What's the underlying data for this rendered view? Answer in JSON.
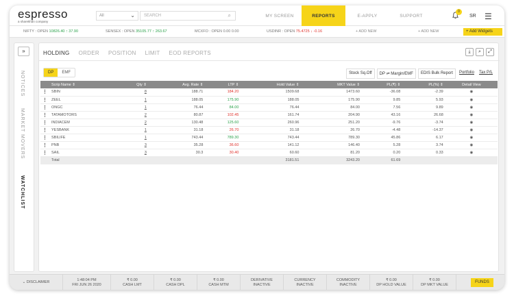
{
  "brand": {
    "name": "espresso",
    "tagline": "a sharekhan company"
  },
  "header": {
    "exchange_selector": "All",
    "search_placeholder": "SEARCH",
    "nav": [
      "MY SCREEN",
      "REPORTS",
      "E-APPLY",
      "SUPPORT"
    ],
    "active_nav": "REPORTS",
    "notification_count": "0",
    "user_initials": "SR"
  },
  "indices": [
    {
      "name": "NIFTY : OPEN",
      "value": "10826.40",
      "change": "37.90",
      "dir": "up"
    },
    {
      "name": "SENSEX : OPEN",
      "value": "35105.77",
      "change": "263.67",
      "dir": "up"
    },
    {
      "name": "MCXFO : OPEN",
      "value": "0.00",
      "change": "0.00",
      "dir": "none"
    },
    {
      "name": "USDINR : OPEN",
      "value": "75.4725",
      "change": "-0.16",
      "dir": "dn"
    }
  ],
  "index_actions": {
    "add_new_1": "+ ADD NEW",
    "add_new_2": "+ ADD NEW",
    "add_widgets": "+ Add Widgets"
  },
  "side_rail": {
    "items": [
      "NOTICES",
      "MARKET MOVERS",
      "WATCHLIST"
    ],
    "active": "WATCHLIST"
  },
  "tabs": [
    "HOLDING",
    "ORDER",
    "POSITION",
    "LIMIT",
    "EOD REPORTS"
  ],
  "active_tab": "HOLDING",
  "segment": {
    "options": [
      "DP",
      "EMF"
    ],
    "active": "DP"
  },
  "actions": {
    "sqoff": "Stock Sq.Off",
    "dp_margin": "DP ⇌ Margin/EMF",
    "edis": "EDIS Bulk Report",
    "portfolio": "Portfolio",
    "tax": "Tax P/L"
  },
  "table": {
    "headers": [
      "Scrip Name ⇕",
      "Qty ⇕",
      "Avg. Rate ⇕",
      "LTP ⇕",
      "Hold Value ⇕",
      "MKT Value ⇕",
      "PL(₹) ⇕",
      "PL(%) ⇕",
      "Detail View"
    ],
    "rows": [
      {
        "scrip": "SBIN",
        "qty": "8",
        "avg": "188.71",
        "ltp": "184.20",
        "ltp_dir": "dn",
        "hold": "1509.68",
        "mkt": "1473.60",
        "pl": "-36.08",
        "plp": "-2.39"
      },
      {
        "scrip": "ZEEL",
        "qty": "1",
        "avg": "188.05",
        "ltp": "175.90",
        "ltp_dir": "up",
        "hold": "188.05",
        "mkt": "175.90",
        "pl": "9.85",
        "plp": "5.93"
      },
      {
        "scrip": "ONGC",
        "qty": "1",
        "avg": "76.44",
        "ltp": "84.00",
        "ltp_dir": "up",
        "hold": "76.44",
        "mkt": "84.00",
        "pl": "7.56",
        "plp": "9.89"
      },
      {
        "scrip": "TATAMOTORS",
        "qty": "2",
        "avg": "80.87",
        "ltp": "102.45",
        "ltp_dir": "dn",
        "hold": "161.74",
        "mkt": "204.90",
        "pl": "43.16",
        "plp": "26.68"
      },
      {
        "scrip": "INDIACEM",
        "qty": "2",
        "avg": "130.48",
        "ltp": "125.60",
        "ltp_dir": "up",
        "hold": "260.96",
        "mkt": "251.20",
        "pl": "-9.76",
        "plp": "-3.74"
      },
      {
        "scrip": "YESBANK",
        "qty": "1",
        "avg": "31.18",
        "ltp": "26.70",
        "ltp_dir": "dn",
        "hold": "31.18",
        "mkt": "26.70",
        "pl": "-4.48",
        "plp": "-14.37"
      },
      {
        "scrip": "SBILIFE",
        "qty": "1",
        "avg": "743.44",
        "ltp": "789.30",
        "ltp_dir": "up",
        "hold": "743.44",
        "mkt": "789.30",
        "pl": "45.86",
        "plp": "6.17"
      },
      {
        "scrip": "PNB",
        "qty": "3",
        "avg": "35.28",
        "ltp": "36.60",
        "ltp_dir": "dn",
        "hold": "141.12",
        "mkt": "146.40",
        "pl": "5.28",
        "plp": "3.74"
      },
      {
        "scrip": "SAIL",
        "qty": "3",
        "avg": "30.3",
        "ltp": "30.40",
        "ltp_dir": "dn",
        "hold": "60.60",
        "mkt": "81.20",
        "pl": "0.20",
        "plp": "0.33"
      }
    ],
    "total": {
      "label": "Total",
      "hold": "3181.51",
      "mkt": "3243.20",
      "pl": "61.69"
    }
  },
  "footer": {
    "disclaimer": "DISCLAIMER",
    "time": "1:48:04 PM",
    "date": "FRI JUN 26 2020",
    "cells": [
      {
        "v": "₹ 0.00",
        "l": "CASH LMT"
      },
      {
        "v": "₹ 0.00",
        "l": "CASH DPL"
      },
      {
        "v": "₹ 0.00",
        "l": "CASH MTM"
      },
      {
        "v": "DERIVATIVE",
        "l": "INACTIVE"
      },
      {
        "v": "CURRENCY",
        "l": "INACTIVE"
      },
      {
        "v": "COMMODITY",
        "l": "INACTIVE"
      },
      {
        "v": "₹ 0.00",
        "l": "DP HOLD VALUE"
      },
      {
        "v": "₹ 0.00",
        "l": "DP MKT VALUE"
      }
    ],
    "funds": "FUNDS"
  },
  "colors": {
    "accent": "#f6d419",
    "up": "#2aa14a",
    "down": "#e0302a",
    "header_gray": "#8a8a8a"
  }
}
